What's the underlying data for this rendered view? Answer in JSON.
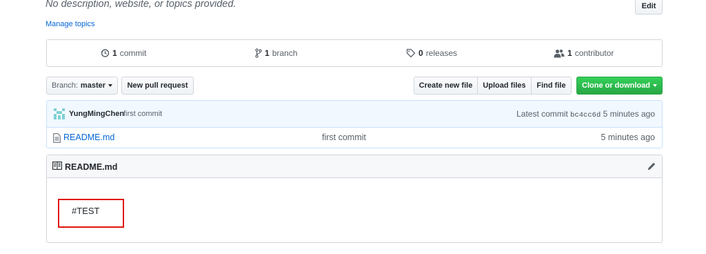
{
  "repo": {
    "description": "No description, website, or topics provided.",
    "manage_topics": "Manage topics",
    "edit_label": "Edit"
  },
  "summary": {
    "commits": {
      "count": "1",
      "label": "commit"
    },
    "branches": {
      "count": "1",
      "label": "branch"
    },
    "releases": {
      "count": "0",
      "label": "releases"
    },
    "contributors": {
      "count": "1",
      "label": "contributor"
    }
  },
  "toolbar": {
    "branch_prefix": "Branch:",
    "branch_name": "master",
    "new_pull_request": "New pull request",
    "create_new_file": "Create new file",
    "upload_files": "Upload files",
    "find_file": "Find file",
    "clone_or_download": "Clone or download"
  },
  "latest_commit": {
    "author": "YungMingChen",
    "message": "first commit",
    "prefix": "Latest commit",
    "sha": "bc4cc6d",
    "age": "5 minutes ago"
  },
  "files": [
    {
      "name": "README.md",
      "message": "first commit",
      "age": "5 minutes ago"
    }
  ],
  "readme": {
    "title": "README.md",
    "content": "#TEST"
  },
  "colors": {
    "link": "#0366d6",
    "green_button": "#28a745",
    "highlight_border": "#e0140c"
  }
}
